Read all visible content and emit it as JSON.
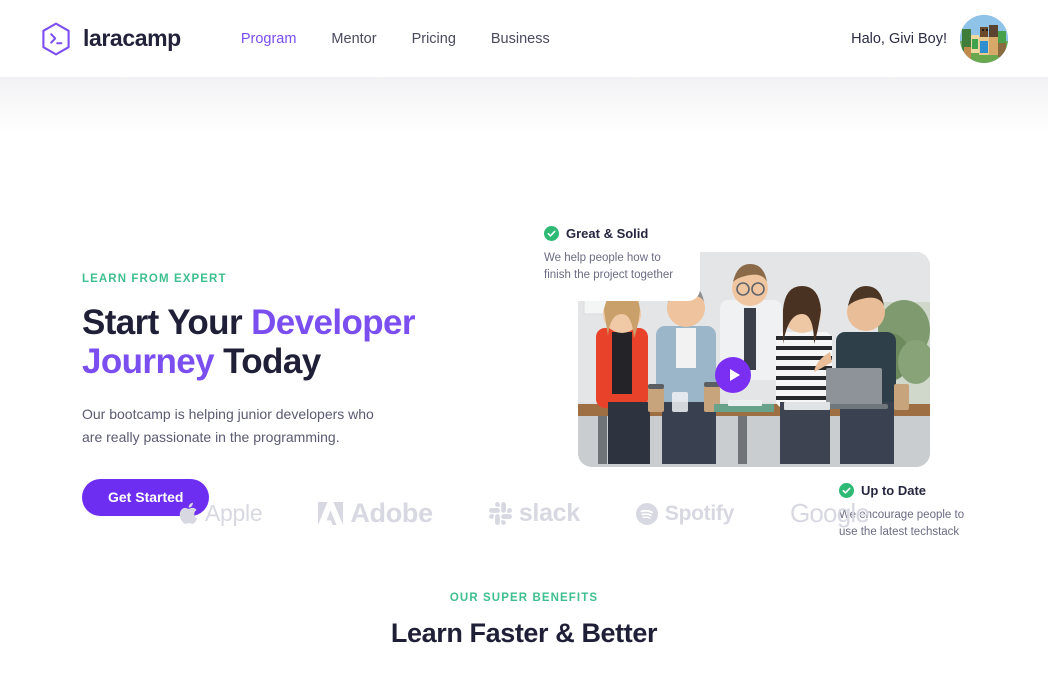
{
  "brand": {
    "name": "laracamp",
    "logo_icon": "hexagon-terminal-icon"
  },
  "nav": {
    "items": [
      {
        "label": "Program",
        "active": true
      },
      {
        "label": "Mentor",
        "active": false
      },
      {
        "label": "Pricing",
        "active": false
      },
      {
        "label": "Business",
        "active": false
      }
    ]
  },
  "user": {
    "greeting": "Halo, Givi Boy!",
    "avatar_icon": "user-avatar"
  },
  "hero": {
    "eyebrow": "LEARN FROM EXPERT",
    "headline_part1": "Start Your ",
    "headline_accent1": "Developer",
    "headline_accent2": "Journey",
    "headline_part2": " Today",
    "subtitle": "Our bootcamp is helping junior developers who are really passionate in the programming.",
    "cta_label": "Get Started",
    "play_icon": "play-icon",
    "cards": [
      {
        "title": "Great & Solid",
        "text": "We help people how to finish the project together",
        "icon": "check-circle-icon"
      },
      {
        "title": "Up to Date",
        "text": "We encourage people to use the latest techstack",
        "icon": "check-circle-icon"
      }
    ]
  },
  "brands": {
    "items": [
      {
        "label": "Apple",
        "icon": "apple-icon"
      },
      {
        "label": "Adobe",
        "icon": "adobe-icon"
      },
      {
        "label": "slack",
        "icon": "slack-icon"
      },
      {
        "label": "Spotify",
        "icon": "spotify-icon"
      },
      {
        "label": "Google",
        "icon": "google-icon"
      }
    ]
  },
  "benefits": {
    "eyebrow": "OUR SUPER BENEFITS",
    "title": "Learn Faster & Better"
  },
  "colors": {
    "purple": "#6d2ef2",
    "purple_light": "#7b4ef0",
    "green": "#3fbf8f",
    "check_green": "#2eba75",
    "dark": "#1f1f38",
    "muted": "#5a5a72",
    "brand_gray": "#d8d8e2"
  }
}
